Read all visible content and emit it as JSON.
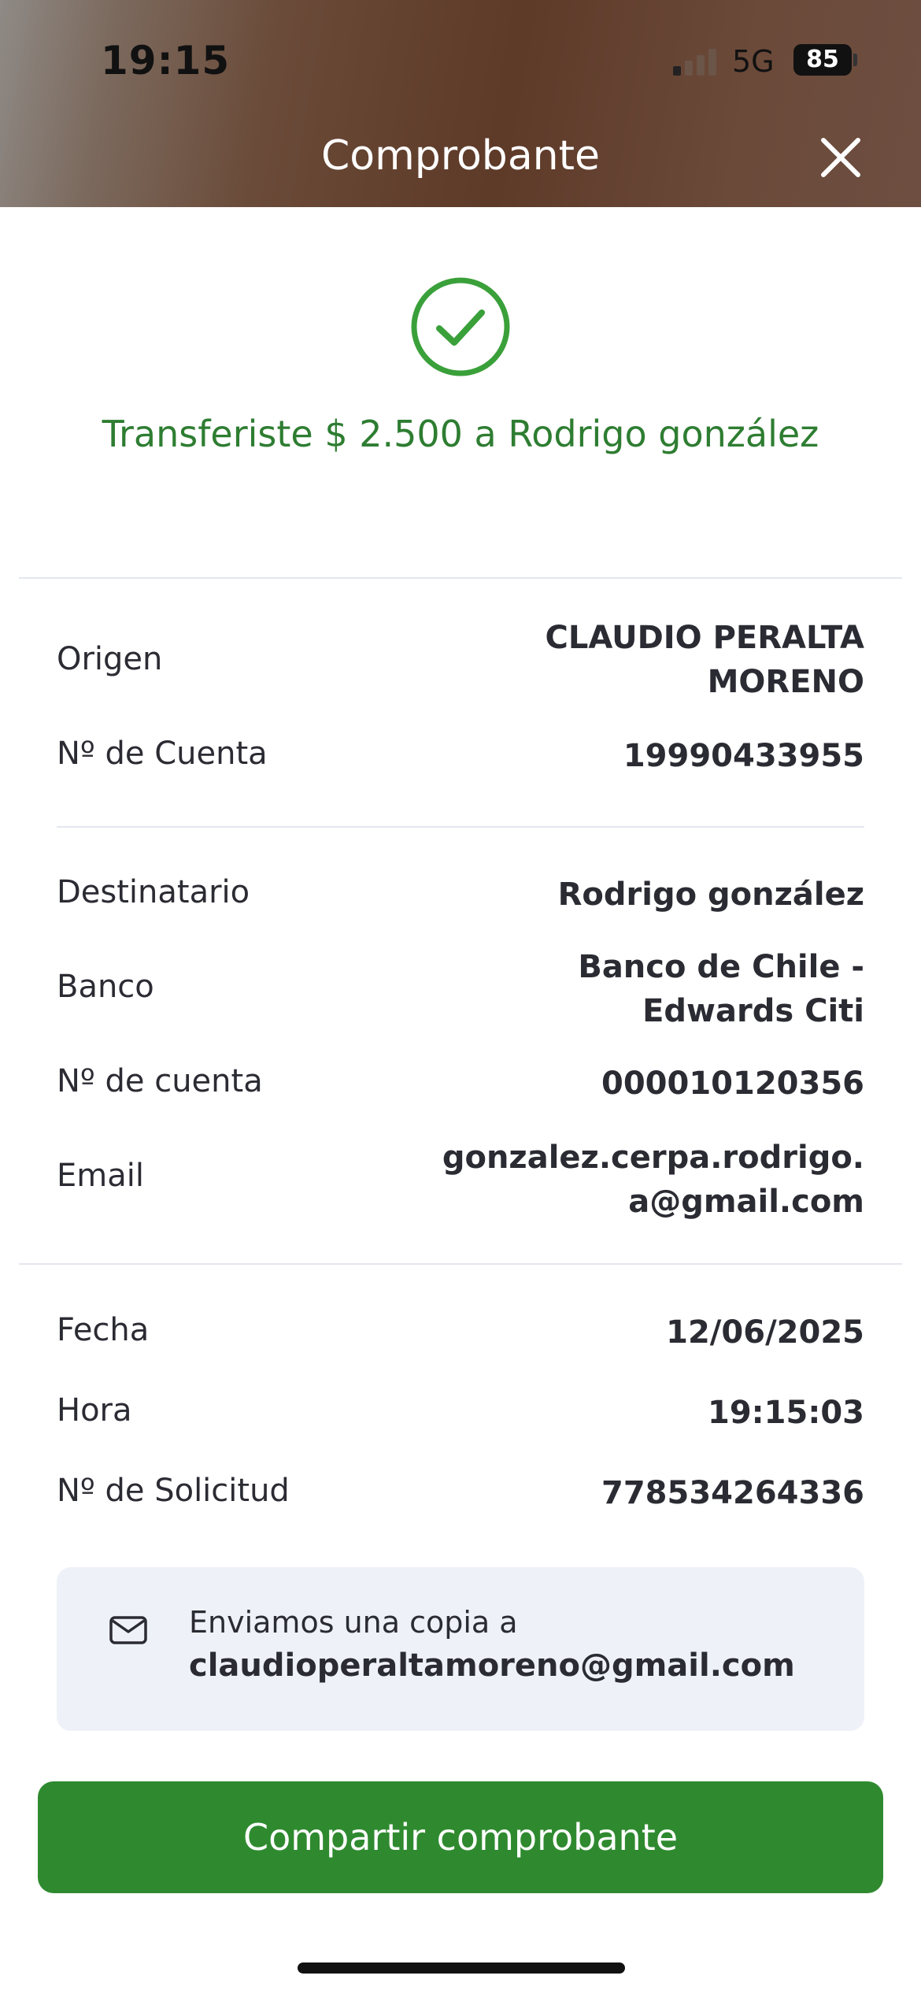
{
  "status_bar": {
    "time": "19:15",
    "network": "5G",
    "battery": "85"
  },
  "header": {
    "title": "Comprobante"
  },
  "confirmation": {
    "message": "Transferiste $ 2.500 a Rodrigo gonzález"
  },
  "origin": {
    "origen_label": "Origen",
    "origen_value_line1": "CLAUDIO PERALTA",
    "origen_value_line2": "MORENO",
    "cuenta_label": "Nº de Cuenta",
    "cuenta_value": "19990433955"
  },
  "recipient": {
    "destinatario_label": "Destinatario",
    "destinatario_value": "Rodrigo gonzález",
    "banco_label": "Banco",
    "banco_value_line1": "Banco de Chile -",
    "banco_value_line2": "Edwards Citi",
    "cuenta_label": "Nº de cuenta",
    "cuenta_value": "000010120356",
    "email_label": "Email",
    "email_value_line1": "gonzalez.cerpa.rodrigo.",
    "email_value_line2": "a@gmail.com"
  },
  "details": {
    "fecha_label": "Fecha",
    "fecha_value": "12/06/2025",
    "hora_label": "Hora",
    "hora_value": "19:15:03",
    "solicitud_label": "Nº de Solicitud",
    "solicitud_value": "778534264336"
  },
  "notice": {
    "line1": "Enviamos una copia a",
    "line2": "claudioperaltamoreno@gmail.com"
  },
  "actions": {
    "share_label": "Compartir comprobante"
  },
  "colors": {
    "accent_green": "#2f8a2f",
    "text_green": "#2e7d32",
    "notice_bg": "#eef2f8"
  }
}
